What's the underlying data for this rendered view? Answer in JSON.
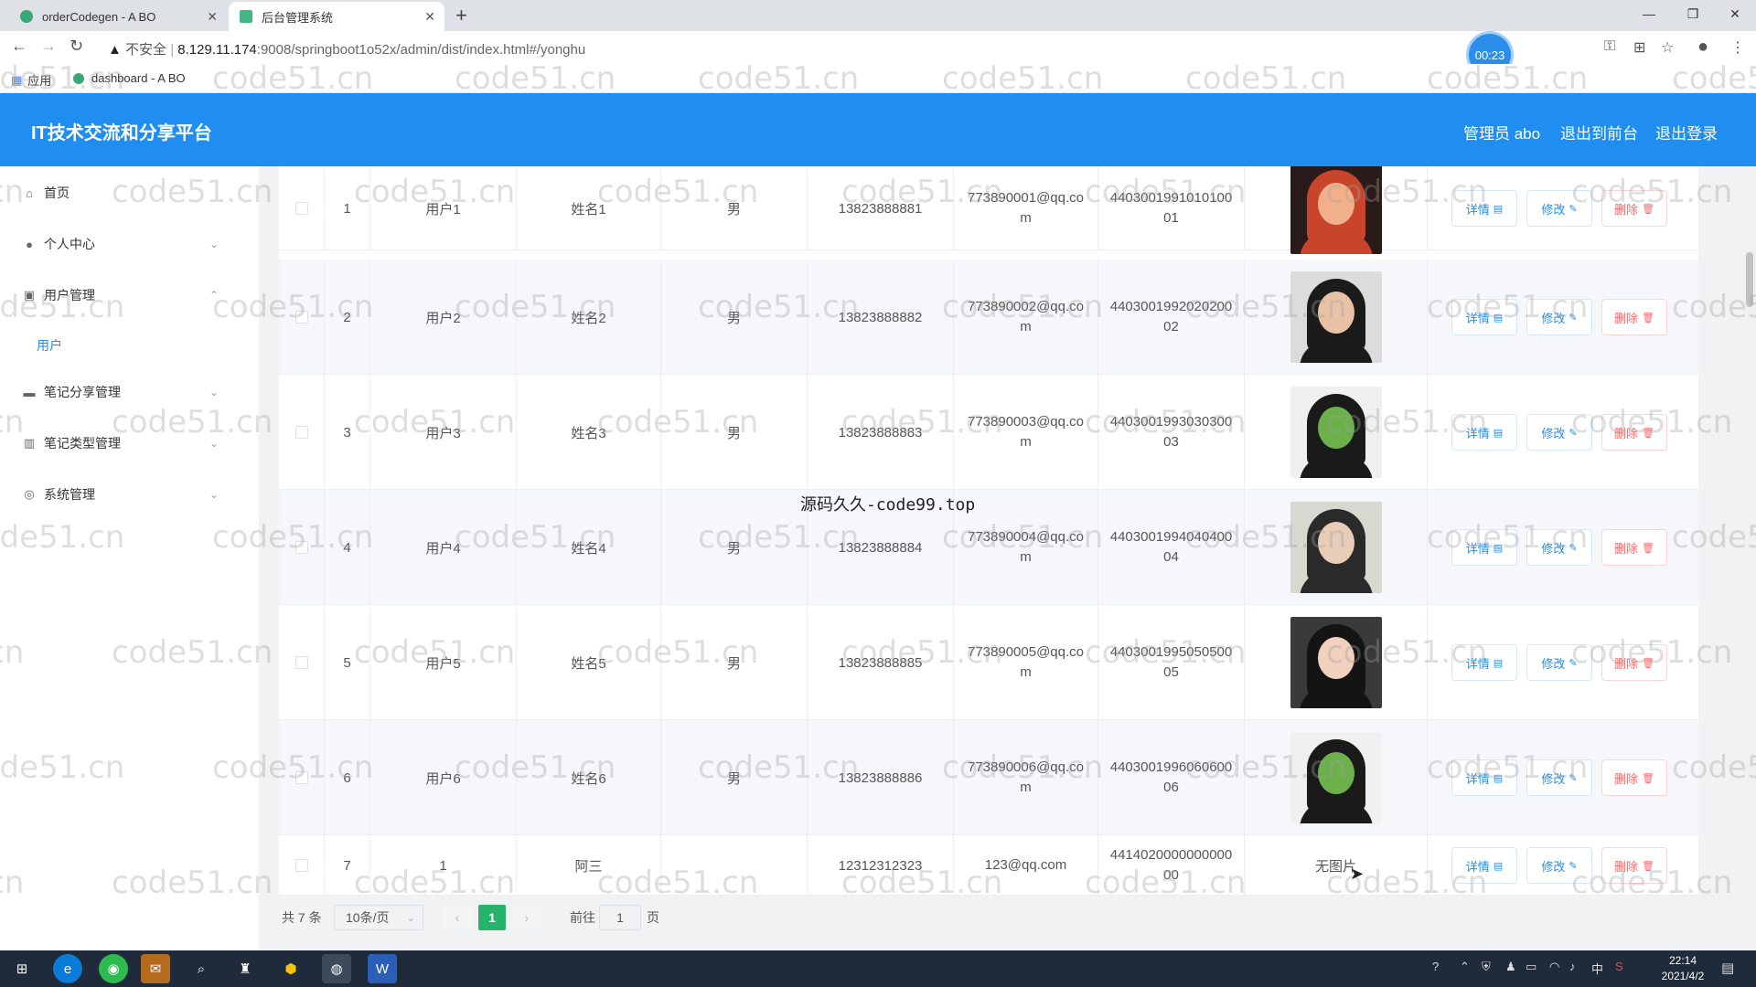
{
  "browser": {
    "tabs": [
      {
        "title": "orderCodegen - A BO",
        "icon": "codegen-icon",
        "active": false
      },
      {
        "title": "后台管理系统",
        "icon": "vue-icon",
        "active": true
      }
    ],
    "new_tab": "+",
    "address": {
      "security": "不安全",
      "host": "8.129.11.174",
      "path": ":9008/springboot1o52x/admin/dist/index.html#/yonghu"
    },
    "timer": "00:23",
    "bookmarks": [
      {
        "label": "应用",
        "icon": "apps-grid-icon"
      },
      {
        "label": "dashboard - A BO",
        "icon": "dashboard-icon"
      }
    ]
  },
  "header": {
    "title": "IT技术交流和分享平台",
    "admin": "管理员 abo",
    "to_front": "退出到前台",
    "logout": "退出登录"
  },
  "sidebar": {
    "items": [
      {
        "label": "首页",
        "icon": "home-icon"
      },
      {
        "label": "个人中心",
        "icon": "user-icon"
      },
      {
        "label": "用户管理",
        "icon": "user-manage-icon"
      },
      {
        "label": "笔记分享管理",
        "icon": "note-share-icon"
      },
      {
        "label": "笔记类型管理",
        "icon": "note-type-icon"
      },
      {
        "label": "系统管理",
        "icon": "system-icon"
      }
    ],
    "sub_item": "用户"
  },
  "table": {
    "rows": [
      {
        "index": "1",
        "account": "用户1",
        "name": "姓名1",
        "gender": "男",
        "phone": "13823888881",
        "email_1": "773890001@qq.co",
        "email_2": "m",
        "id_1": "4403001991010100",
        "id_2": "01",
        "photo": "avatar-photo-1"
      },
      {
        "index": "2",
        "account": "用户2",
        "name": "姓名2",
        "gender": "男",
        "phone": "13823888882",
        "email_1": "773890002@qq.co",
        "email_2": "m",
        "id_1": "4403001992020200",
        "id_2": "02",
        "photo": "avatar-photo-2"
      },
      {
        "index": "3",
        "account": "用户3",
        "name": "姓名3",
        "gender": "男",
        "phone": "13823888883",
        "email_1": "773890003@qq.co",
        "email_2": "m",
        "id_1": "4403001993030300",
        "id_2": "03",
        "photo": "avatar-photo-3"
      },
      {
        "index": "4",
        "account": "用户4",
        "name": "姓名4",
        "gender": "男",
        "phone": "13823888884",
        "email_1": "773890004@qq.co",
        "email_2": "m",
        "id_1": "4403001994040400",
        "id_2": "04",
        "photo": "avatar-photo-4"
      },
      {
        "index": "5",
        "account": "用户5",
        "name": "姓名5",
        "gender": "男",
        "phone": "13823888885",
        "email_1": "773890005@qq.co",
        "email_2": "m",
        "id_1": "4403001995050500",
        "id_2": "05",
        "photo": "avatar-photo-5"
      },
      {
        "index": "6",
        "account": "用户6",
        "name": "姓名6",
        "gender": "男",
        "phone": "13823888886",
        "email_1": "773890006@qq.co",
        "email_2": "m",
        "id_1": "4403001996060600",
        "id_2": "06",
        "photo": "avatar-photo-6"
      },
      {
        "index": "7",
        "account": "1",
        "name": "阿三",
        "gender": "",
        "phone": "12312312323",
        "email_1": "123@qq.com",
        "email_2": "",
        "id_1": "4414020000000000",
        "id_2": "00",
        "photo_text": "无图片"
      }
    ],
    "actions": {
      "detail": "详情",
      "edit": "修改",
      "delete": "删除"
    }
  },
  "pagination": {
    "total": "共 7 条",
    "page_size": "10条/页",
    "current_page": "1",
    "goto_prefix": "前往",
    "goto_value": "1",
    "goto_suffix": "页"
  },
  "watermark": {
    "text": "code51.cn",
    "center_text": "源码久久-code99.top"
  },
  "taskbar": {
    "time": "22:14",
    "date": "2021/4/2",
    "ime": "中"
  },
  "colors": {
    "header_bg": "#1f8ef0",
    "accent": "#1f8ef0",
    "pager_active": "#27b36b",
    "danger": "#f56c6c"
  }
}
